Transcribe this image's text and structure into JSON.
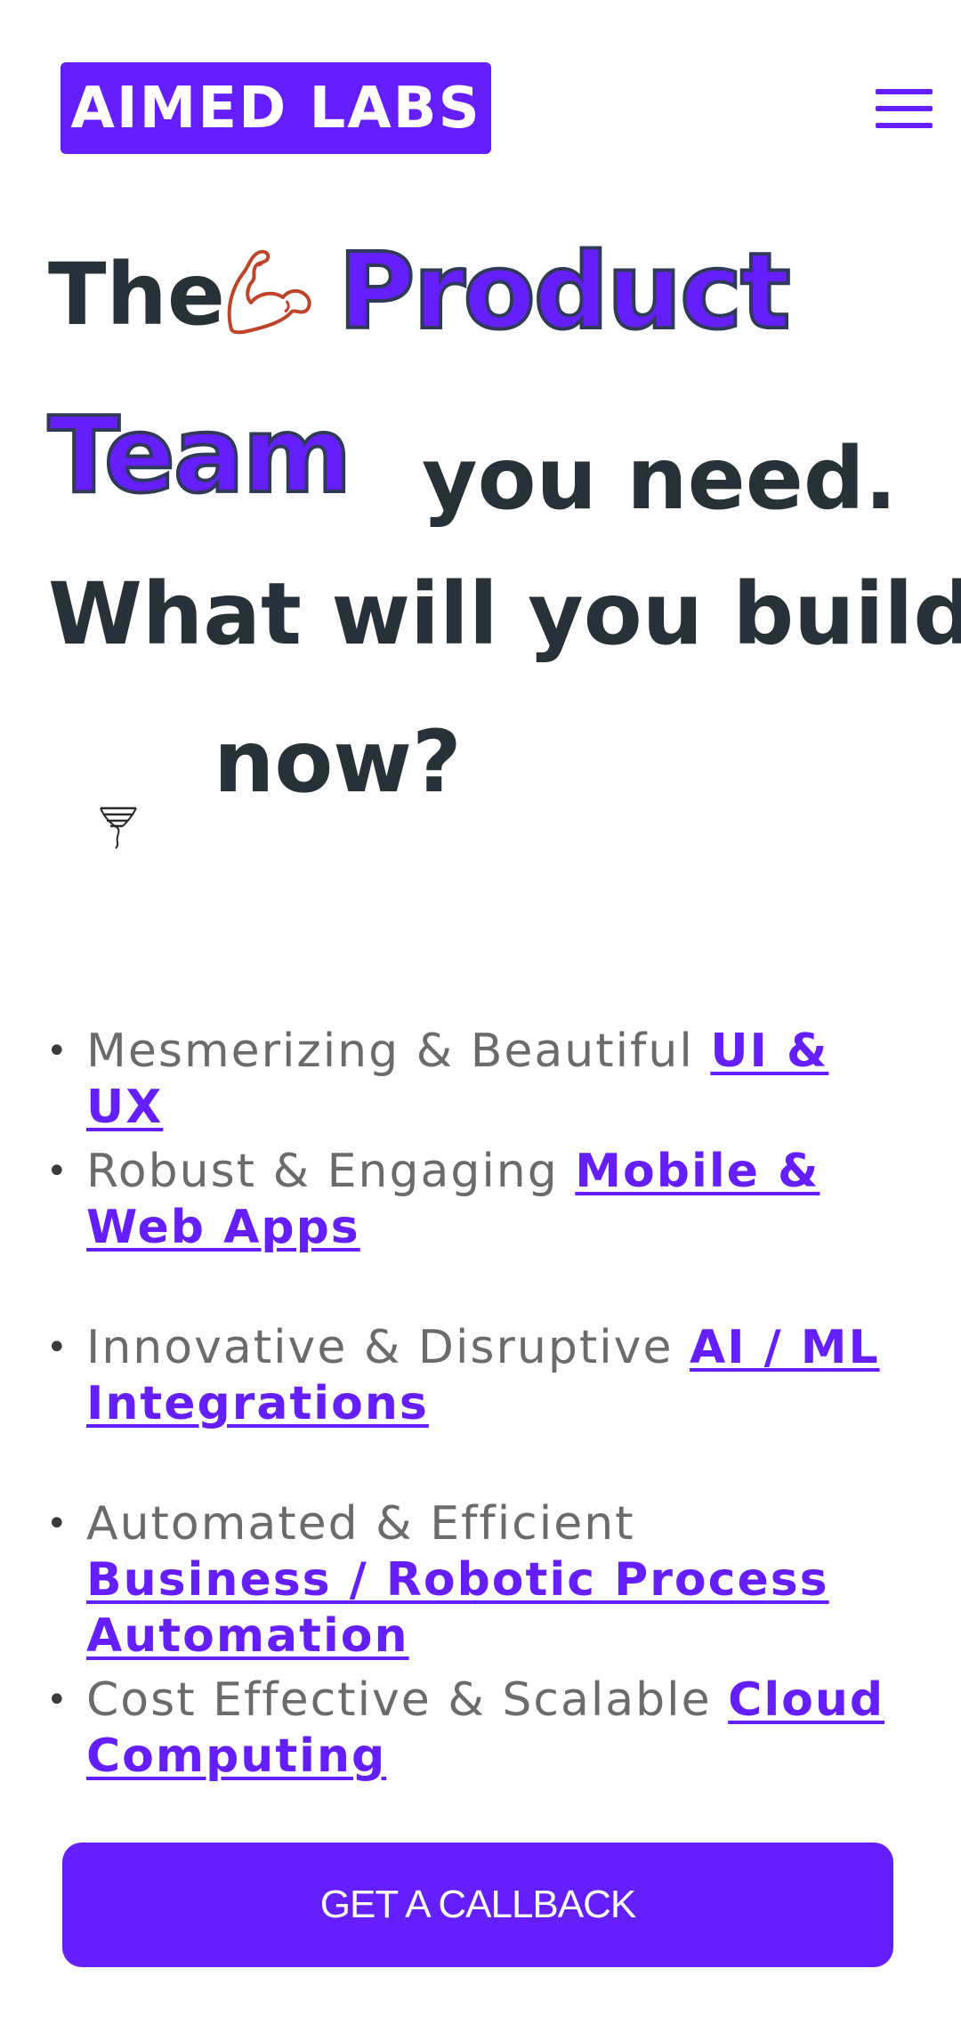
{
  "brand": {
    "logo_text": "AIMED LABS",
    "accent_color": "#651fff",
    "text_color": "#263238"
  },
  "header": {
    "menu_icon": "hamburger-menu-icon"
  },
  "hero": {
    "line1_prefix": "The",
    "muscle_icon": "flexed-biceps-icon",
    "highlight_word_1": "Product",
    "highlight_word_2": "Team",
    "line2_suffix": "you need.",
    "line3": "What will you build",
    "line4": "now?",
    "tornado_icon": "tornado-icon"
  },
  "features": [
    {
      "text": "Mesmerizing & Beautiful ",
      "link": "UI & UX"
    },
    {
      "text": "Robust & Engaging ",
      "link": "Mobile & Web Apps"
    },
    {
      "text": "Innovative & Disruptive ",
      "link": "AI / ML Integrations"
    },
    {
      "text": "Automated & Efficient ",
      "link": "Business / Robotic Process Automation"
    },
    {
      "text": "Cost Effective & Scalable ",
      "link": "Cloud Computing"
    }
  ],
  "cta": {
    "label": "GET A CALLBACK"
  }
}
